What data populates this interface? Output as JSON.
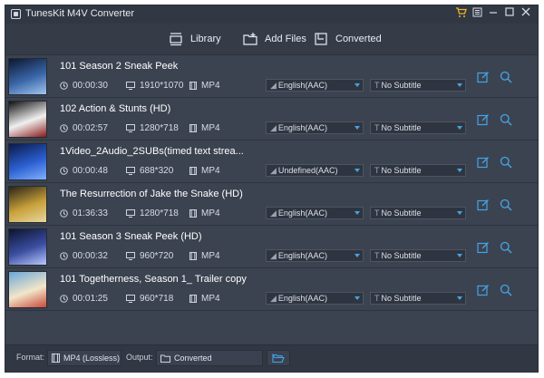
{
  "app": {
    "title": "TunesKit M4V Converter"
  },
  "toolbar": {
    "library": "Library",
    "add_files": "Add Files",
    "converted": "Converted"
  },
  "rows": [
    {
      "title": "101 Season 2 Sneak Peek",
      "duration": "00:00:30",
      "resolution": "1910*1070",
      "format": "MP4",
      "audio": "English(AAC)",
      "subtitle": "No Subtitle",
      "thumb": [
        "#0c1830",
        "#3a66a8",
        "#9fc6ef"
      ]
    },
    {
      "title": "102 Action & Stunts (HD)",
      "duration": "00:02:57",
      "resolution": "1280*718",
      "format": "MP4",
      "audio": "English(AAC)",
      "subtitle": "No Subtitle",
      "thumb": [
        "#101010",
        "#f0f0f0",
        "#8a1a1a"
      ]
    },
    {
      "title": "1Video_2Audio_2SUBs(timed text strea...",
      "duration": "00:00:48",
      "resolution": "688*320",
      "format": "MP4",
      "audio": "Undefined(AAC)",
      "subtitle": "No Subtitle",
      "thumb": [
        "#0b1a4a",
        "#2b5fd0",
        "#7fb0ff"
      ]
    },
    {
      "title": "The Resurrection of Jake the Snake (HD)",
      "duration": "01:36:33",
      "resolution": "1280*718",
      "format": "MP4",
      "audio": "English(AAC)",
      "subtitle": "No Subtitle",
      "thumb": [
        "#2a2418",
        "#c8a13a",
        "#e8d7a0"
      ]
    },
    {
      "title": "101 Season 3 Sneak Peek (HD)",
      "duration": "00:00:32",
      "resolution": "960*720",
      "format": "MP4",
      "audio": "English(AAC)",
      "subtitle": "No Subtitle",
      "thumb": [
        "#0b1430",
        "#3b4ea0",
        "#b8c8ff"
      ]
    },
    {
      "title": "101 Togetherness, Season 1_ Trailer copy",
      "duration": "00:01:25",
      "resolution": "960*718",
      "format": "MP4",
      "audio": "English(AAC)",
      "subtitle": "No Subtitle",
      "thumb": [
        "#6aa6d8",
        "#f2e6c9",
        "#c94a3a"
      ]
    }
  ],
  "bottom": {
    "format_label": "Format:",
    "format_value": "MP4 (Lossless)",
    "output_label": "Output:",
    "output_value": "Converted"
  },
  "colors": {
    "accent": "#44a4e6",
    "cart": "#f0b623",
    "background": "#3b4350"
  }
}
